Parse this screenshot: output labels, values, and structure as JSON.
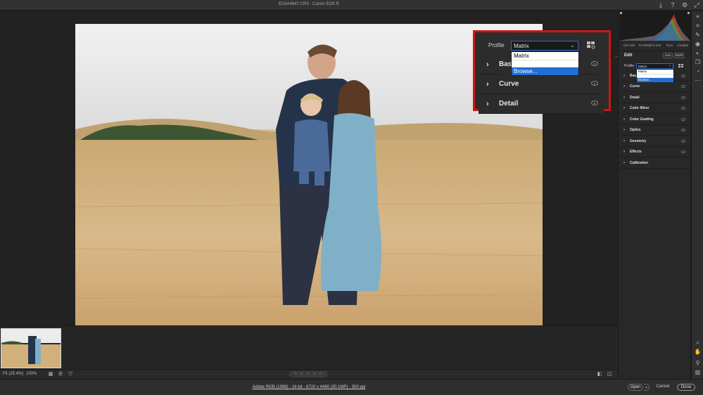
{
  "title_bar": {
    "title": "EC6A4847.CR3  -  Canon EOS R",
    "icons": [
      "save-icon",
      "help-icon",
      "gear-icon",
      "expand-icon"
    ]
  },
  "zoom_callout": {
    "profile_label": "Profile",
    "profile_value": "Matrix",
    "dropdown_options": [
      "Matrix",
      "",
      "Browse..."
    ],
    "selected_option": "Browse...",
    "sections": [
      {
        "label": "Basic"
      },
      {
        "label": "Curve"
      },
      {
        "label": "Detail"
      }
    ]
  },
  "filmstrip": {
    "thumbnails": 1
  },
  "bottom_bar": {
    "fit_label": "Fit (25.4%)",
    "zoom_value": "100%",
    "stars": "☆ ☆ ☆ ☆ ☆"
  },
  "footer": {
    "workflow_info": "Adobe RGB (1998) - 16 bit - 6720 x 4480 (30.1MP) - 300 ppi",
    "open_label": "Open",
    "cancel_label": "Cancel",
    "done_label": "Done"
  },
  "panel": {
    "exif": {
      "iso": "ISO 200",
      "lens": "70-200@70 mm",
      "aperture": "f/2.8",
      "shutter": "1/1250s"
    },
    "edit_label": "Edit",
    "auto_label": "Auto",
    "bw_label": "B&W",
    "profile_label": "Profile",
    "profile_value": "Matrix",
    "dropdown_options": [
      "Matrix",
      "",
      "Browse..."
    ],
    "sections": [
      {
        "label": "Basic"
      },
      {
        "label": "Curve"
      },
      {
        "label": "Detail"
      },
      {
        "label": "Color Mixer"
      },
      {
        "label": "Color Grading"
      },
      {
        "label": "Optics"
      },
      {
        "label": "Geometry"
      },
      {
        "label": "Effects"
      },
      {
        "label": "Calibration"
      }
    ]
  },
  "colors": {
    "highlight_red": "#d01515",
    "selection_blue": "#1f6fd6",
    "panel_bg": "#282828"
  }
}
